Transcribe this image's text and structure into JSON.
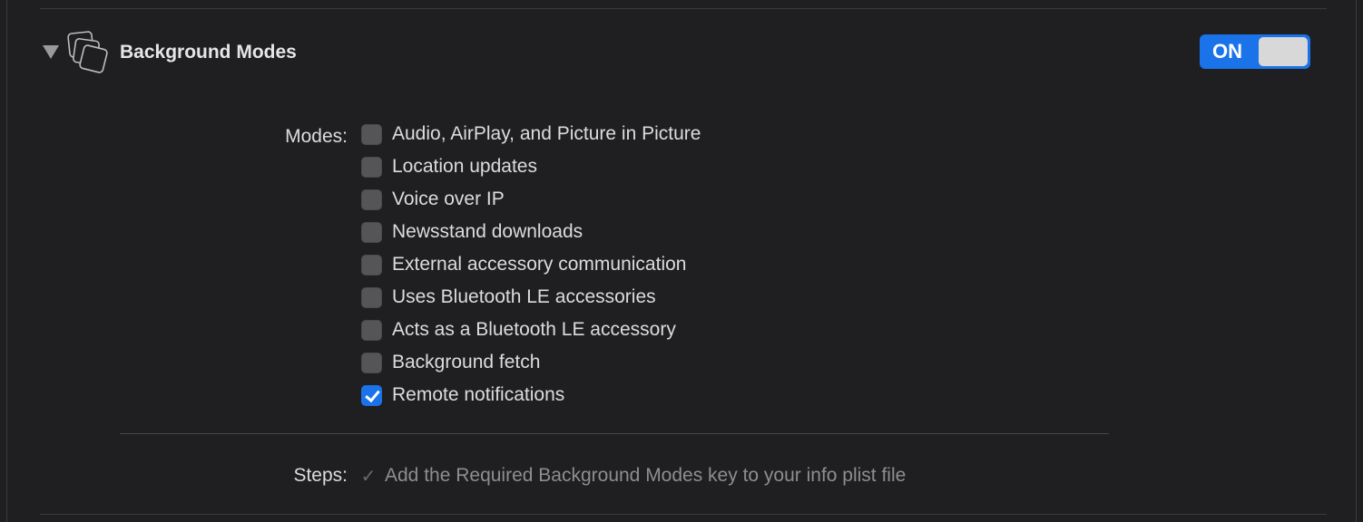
{
  "section": {
    "title": "Background Modes",
    "icon": "stacked-windows-icon",
    "toggle": {
      "label": "ON",
      "state": "on",
      "accent": "#1a73e8"
    }
  },
  "modes": {
    "label": "Modes:",
    "items": [
      {
        "label": "Audio, AirPlay, and Picture in Picture",
        "checked": false
      },
      {
        "label": "Location updates",
        "checked": false
      },
      {
        "label": "Voice over IP",
        "checked": false
      },
      {
        "label": "Newsstand downloads",
        "checked": false
      },
      {
        "label": "External accessory communication",
        "checked": false
      },
      {
        "label": "Uses Bluetooth LE accessories",
        "checked": false
      },
      {
        "label": "Acts as a Bluetooth LE accessory",
        "checked": false
      },
      {
        "label": "Background fetch",
        "checked": false
      },
      {
        "label": "Remote notifications",
        "checked": true
      }
    ]
  },
  "steps": {
    "label": "Steps:",
    "items": [
      {
        "text": "Add the Required Background Modes key to your info plist file",
        "done": true
      }
    ]
  },
  "colors": {
    "background": "#1f1f21",
    "accent": "#1a73e8",
    "text": "#dcdcdc",
    "muted_text": "#8e8e90"
  }
}
